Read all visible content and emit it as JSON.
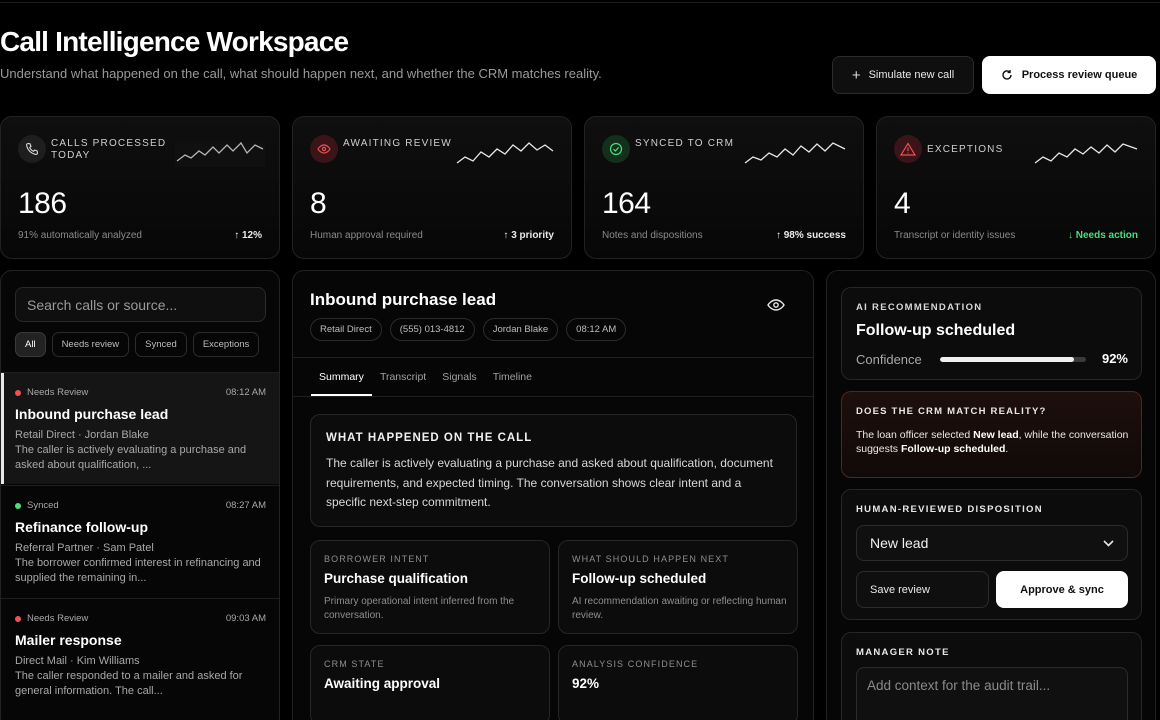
{
  "header": {
    "title": "Call Intelligence Workspace",
    "subtitle": "Understand what happened on the call, what should happen next, and whether the CRM matches reality.",
    "simulate_label": "Simulate new call",
    "process_label": "Process review queue"
  },
  "stats": [
    {
      "label": "Calls processed today",
      "value": "186",
      "caption": "91% automatically analyzed",
      "trend": "↑ 12%",
      "icon": "phone-icon",
      "accent": "#2a2a2a"
    },
    {
      "label": "Awaiting review",
      "value": "8",
      "caption": "Human approval required",
      "trend": "↑ 3 priority",
      "icon": "eye-icon",
      "accent": "#3a1418"
    },
    {
      "label": "Synced to CRM",
      "value": "164",
      "caption": "Notes and dispositions",
      "trend": "↑ 98% success",
      "icon": "check-circle-icon",
      "accent": "#12301c"
    },
    {
      "label": "Exceptions",
      "value": "4",
      "caption": "Transcript or identity issues",
      "trend": "↓ Needs action",
      "icon": "warning-icon",
      "accent": "#3a1418"
    }
  ],
  "list": {
    "search_placeholder": "Search calls or source...",
    "filters": [
      "All",
      "Needs review",
      "Synced",
      "Exceptions"
    ],
    "items": [
      {
        "status": "Needs Review",
        "status_color": "#ef5350",
        "time": "08:12 AM",
        "title": "Inbound purchase lead",
        "source": "Retail Direct · Jordan Blake",
        "desc": "The caller is actively evaluating a purchase and asked about qualification, ..."
      },
      {
        "status": "Synced",
        "status_color": "#4ade80",
        "time": "08:27 AM",
        "title": "Refinance follow-up",
        "source": "Referral Partner · Sam Patel",
        "desc": "The borrower confirmed interest in refinancing and supplied the remaining in..."
      },
      {
        "status": "Needs Review",
        "status_color": "#ef5350",
        "time": "09:03 AM",
        "title": "Mailer response",
        "source": "Direct Mail · Kim Williams",
        "desc": "The caller responded to a mailer and asked for general information. The call..."
      }
    ]
  },
  "detail": {
    "title": "Inbound purchase lead",
    "tags": [
      "Retail Direct",
      "(555) 013-4812",
      "Jordan Blake",
      "08:12 AM"
    ],
    "tabs": [
      "Summary",
      "Transcript",
      "Signals",
      "Timeline"
    ],
    "what_heading": "WHAT HAPPENED ON THE CALL",
    "what_text": "The caller is actively evaluating a purchase and asked about qualification, document requirements, and expected timing. The conversation shows clear intent and a specific next-step commitment.",
    "borrower_intent": {
      "label": "Borrower intent",
      "value": "Purchase qualification",
      "desc": "Primary operational intent inferred from the conversation."
    },
    "next_step": {
      "label": "What should happen next",
      "value": "Follow-up scheduled",
      "desc": "AI recommendation awaiting or reflecting human review."
    },
    "crm_state": {
      "label": "CRM state",
      "value": "Awaiting approval"
    },
    "analysis_confidence": {
      "label": "Analysis confidence",
      "value": "92%"
    }
  },
  "right": {
    "rec_label": "AI RECOMMENDATION",
    "rec_value": "Follow-up scheduled",
    "confidence_label": "Confidence",
    "confidence_pct": "92%",
    "confidence_fraction": 0.92,
    "crm_heading": "DOES THE CRM MATCH REALITY?",
    "crm_p1": "The loan officer selected ",
    "crm_b1": "New lead",
    "crm_p2": ", while the conversation suggests ",
    "crm_b2": "Follow-up scheduled",
    "crm_p3": ".",
    "disp_heading": "HUMAN-REVIEWED DISPOSITION",
    "disp_value": "New lead",
    "save_label": "Save review",
    "approve_label": "Approve & sync",
    "note_heading": "MANAGER NOTE",
    "note_placeholder": "Add context for the audit trail..."
  }
}
